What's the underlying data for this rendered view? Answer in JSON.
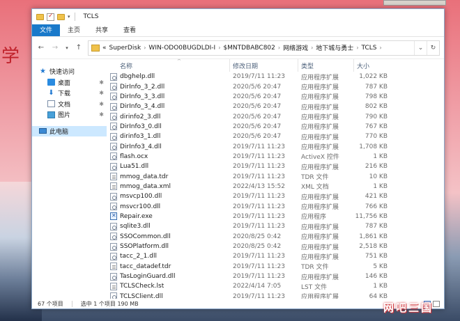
{
  "window": {
    "title": "TCLS"
  },
  "ribbon": {
    "tabs": [
      "文件",
      "主页",
      "共享",
      "查看"
    ]
  },
  "address": {
    "prefix": "«",
    "crumbs": [
      "SuperDisk",
      "WIN-ODO0BUGDLDI-I",
      "$MNTDBABC802",
      "网络游戏",
      "地下城与勇士",
      "TCLS"
    ]
  },
  "nav": {
    "items": [
      {
        "label": "快速访问",
        "icon": "star-icon"
      },
      {
        "label": "桌面",
        "icon": "desktop-icon"
      },
      {
        "label": "下载",
        "icon": "download-icon"
      },
      {
        "label": "文档",
        "icon": "documents-icon"
      },
      {
        "label": "图片",
        "icon": "pictures-icon"
      },
      {
        "label": "此电脑",
        "icon": "computer-icon"
      }
    ]
  },
  "columns": {
    "name": "名称",
    "date": "修改日期",
    "type": "类型",
    "size": "大小"
  },
  "files": [
    {
      "name": "dbghelp.dll",
      "date": "2019/7/11 11:23",
      "type": "应用程序扩展",
      "size": "1,022 KB",
      "kind": "dll"
    },
    {
      "name": "DirInfo_3_2.dll",
      "date": "2020/5/6 20:47",
      "type": "应用程序扩展",
      "size": "787 KB",
      "kind": "dll"
    },
    {
      "name": "DirInfo_3_3.dll",
      "date": "2020/5/6 20:47",
      "type": "应用程序扩展",
      "size": "798 KB",
      "kind": "dll"
    },
    {
      "name": "DirInfo_3_4.dll",
      "date": "2020/5/6 20:47",
      "type": "应用程序扩展",
      "size": "802 KB",
      "kind": "dll"
    },
    {
      "name": "dirinfo2_3.dll",
      "date": "2020/5/6 20:47",
      "type": "应用程序扩展",
      "size": "790 KB",
      "kind": "dll"
    },
    {
      "name": "DirInfo3_0.dll",
      "date": "2020/5/6 20:47",
      "type": "应用程序扩展",
      "size": "767 KB",
      "kind": "dll"
    },
    {
      "name": "dirinfo3_1.dll",
      "date": "2020/5/6 20:47",
      "type": "应用程序扩展",
      "size": "770 KB",
      "kind": "dll"
    },
    {
      "name": "DirInfo3_4.dll",
      "date": "2019/7/11 11:23",
      "type": "应用程序扩展",
      "size": "1,708 KB",
      "kind": "dll"
    },
    {
      "name": "flash.ocx",
      "date": "2019/7/11 11:23",
      "type": "ActiveX 控件",
      "size": "1 KB",
      "kind": "dll"
    },
    {
      "name": "Lua51.dll",
      "date": "2019/7/11 11:23",
      "type": "应用程序扩展",
      "size": "216 KB",
      "kind": "dll"
    },
    {
      "name": "mmog_data.tdr",
      "date": "2019/7/11 11:23",
      "type": "TDR 文件",
      "size": "10 KB",
      "kind": "doc"
    },
    {
      "name": "mmog_data.xml",
      "date": "2022/4/13 15:52",
      "type": "XML 文档",
      "size": "1 KB",
      "kind": "doc"
    },
    {
      "name": "msvcp100.dll",
      "date": "2019/7/11 11:23",
      "type": "应用程序扩展",
      "size": "421 KB",
      "kind": "dll"
    },
    {
      "name": "msvcr100.dll",
      "date": "2019/7/11 11:23",
      "type": "应用程序扩展",
      "size": "766 KB",
      "kind": "dll"
    },
    {
      "name": "Repair.exe",
      "date": "2019/7/11 11:23",
      "type": "应用程序",
      "size": "11,756 KB",
      "kind": "exe"
    },
    {
      "name": "sqlite3.dll",
      "date": "2019/7/11 11:23",
      "type": "应用程序扩展",
      "size": "787 KB",
      "kind": "dll"
    },
    {
      "name": "SSOCommon.dll",
      "date": "2020/8/25 0:42",
      "type": "应用程序扩展",
      "size": "1,861 KB",
      "kind": "dll"
    },
    {
      "name": "SSOPlatform.dll",
      "date": "2020/8/25 0:42",
      "type": "应用程序扩展",
      "size": "2,518 KB",
      "kind": "dll"
    },
    {
      "name": "tacc_2_1.dll",
      "date": "2019/7/11 11:23",
      "type": "应用程序扩展",
      "size": "751 KB",
      "kind": "dll"
    },
    {
      "name": "tacc_datadef.tdr",
      "date": "2019/7/11 11:23",
      "type": "TDR 文件",
      "size": "5 KB",
      "kind": "doc"
    },
    {
      "name": "TasLoginGuard.dll",
      "date": "2019/7/11 11:23",
      "type": "应用程序扩展",
      "size": "146 KB",
      "kind": "dll"
    },
    {
      "name": "TCLSCheck.lst",
      "date": "2022/4/14 7:05",
      "type": "LST 文件",
      "size": "1 KB",
      "kind": "doc"
    },
    {
      "name": "TCLSClient.dll",
      "date": "2019/7/11 11:23",
      "type": "应用程序扩展",
      "size": "64 KB",
      "kind": "dll"
    }
  ],
  "status": {
    "count": "67 个项目",
    "selected": "选中 1 个项目 190 MB"
  },
  "background": {
    "text": "学"
  },
  "watermark": "网吧三国",
  "colors": {
    "accent": "#1979ca",
    "selection": "#cce8ff"
  }
}
